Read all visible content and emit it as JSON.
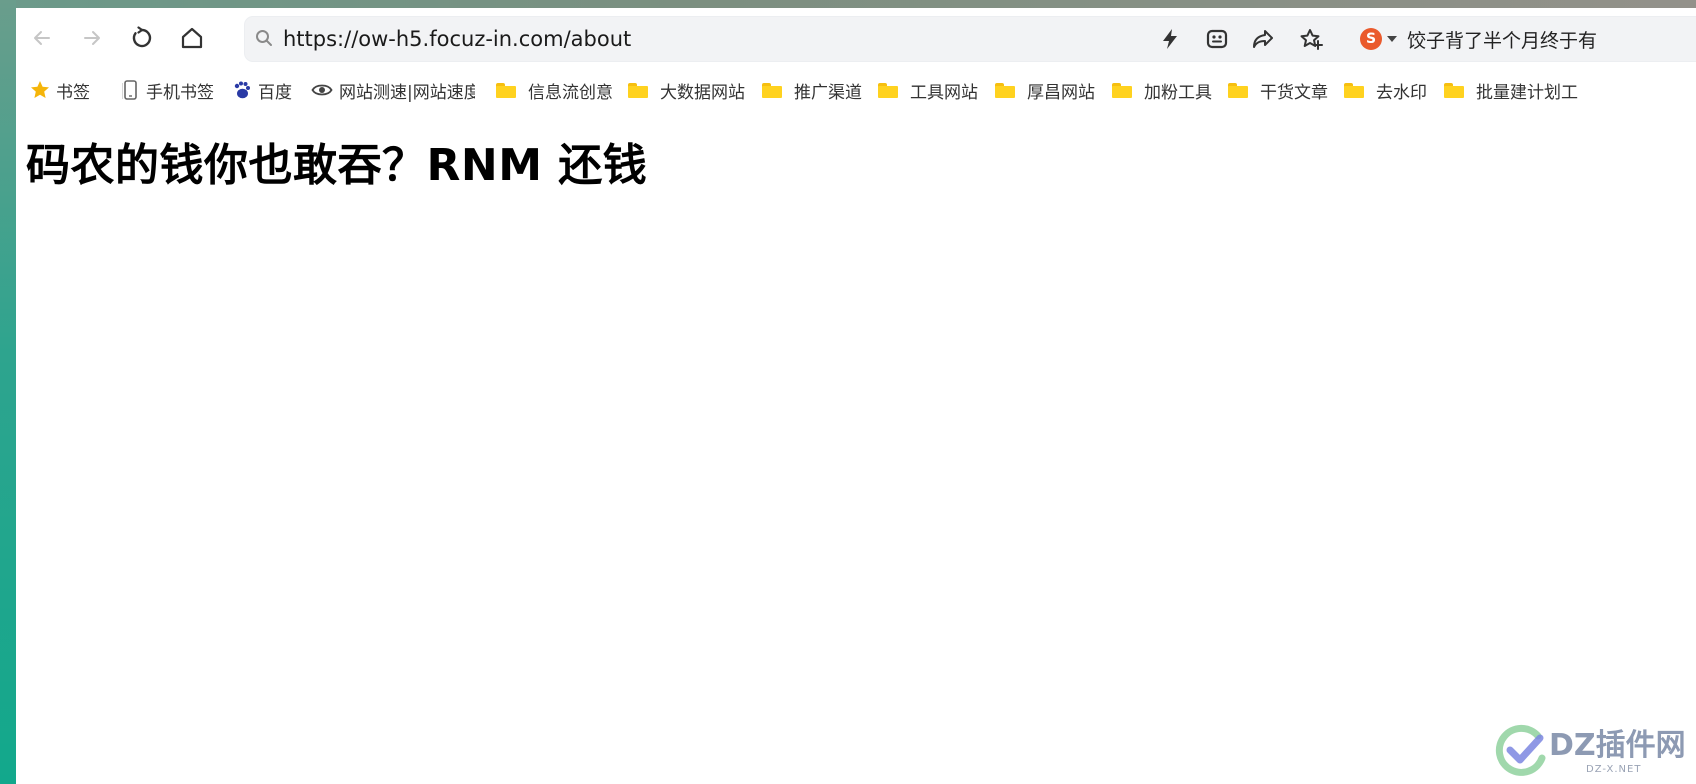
{
  "browser": {
    "nav": {
      "back_icon": "arrow-left-icon",
      "forward_icon": "arrow-right-icon",
      "reload_icon": "reload-icon",
      "home_icon": "home-icon"
    },
    "url": "https://ow-h5.focuz-in.com/about",
    "actions": [
      "lightning-icon",
      "extension-icon",
      "share-icon",
      "favorite-star-icon"
    ],
    "search_engine": {
      "logo_letter": "S",
      "hot_text": "饺子背了半个月终于有"
    }
  },
  "bookmarks": {
    "items": [
      {
        "icon": "star-icon",
        "label": "书签"
      },
      {
        "icon": "phone-icon",
        "label": "手机书签"
      },
      {
        "icon": "baidu-icon",
        "label": "百度"
      },
      {
        "icon": "eye-icon",
        "label": "网站测速|网站速度"
      },
      {
        "icon": "folder-icon",
        "label": "信息流创意"
      },
      {
        "icon": "folder-icon",
        "label": "大数据网站"
      },
      {
        "icon": "folder-icon",
        "label": "推广渠道"
      },
      {
        "icon": "folder-icon",
        "label": "工具网站"
      },
      {
        "icon": "folder-icon",
        "label": "厚昌网站"
      },
      {
        "icon": "folder-icon",
        "label": "加粉工具"
      },
      {
        "icon": "folder-icon",
        "label": "干货文章"
      },
      {
        "icon": "folder-icon",
        "label": "去水印"
      },
      {
        "icon": "folder-icon",
        "label": "批量建计划工"
      }
    ]
  },
  "page": {
    "heading": "码农的钱你也敢吞？RNM 还钱"
  },
  "watermark": {
    "text": "DZ插件网",
    "sub": "DZ-X.NET"
  },
  "colors": {
    "folder": "#ffd21f",
    "star": "#f5b50a",
    "sogou": "#ea5a2c"
  }
}
